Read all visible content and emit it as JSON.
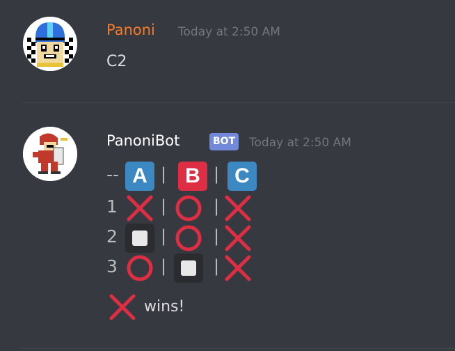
{
  "messages": [
    {
      "author": "Panoni",
      "author_color": "#f47b28",
      "timestamp": "Today at 2:50 AM",
      "text": "C2"
    },
    {
      "author": "PanoniBot",
      "author_color": "#ffffff",
      "badge": "BOT",
      "timestamp": "Today at 2:50 AM",
      "board": {
        "header_prefix": "--",
        "columns": [
          "A",
          "B",
          "C"
        ],
        "column_colors": [
          "#3b88c3",
          "#dd2e44",
          "#3b88c3"
        ],
        "separator": "|",
        "rows": [
          {
            "label": "1",
            "cells": [
              "cross",
              "circle",
              "cross"
            ]
          },
          {
            "label": "2",
            "cells": [
              "empty",
              "circle",
              "cross"
            ]
          },
          {
            "label": "3",
            "cells": [
              "circle",
              "empty",
              "cross"
            ]
          }
        ]
      },
      "result_icon": "cross",
      "result_text": "wins!"
    }
  ],
  "colors": {
    "mark_red": "#dd2e44",
    "background": "#36393f"
  }
}
